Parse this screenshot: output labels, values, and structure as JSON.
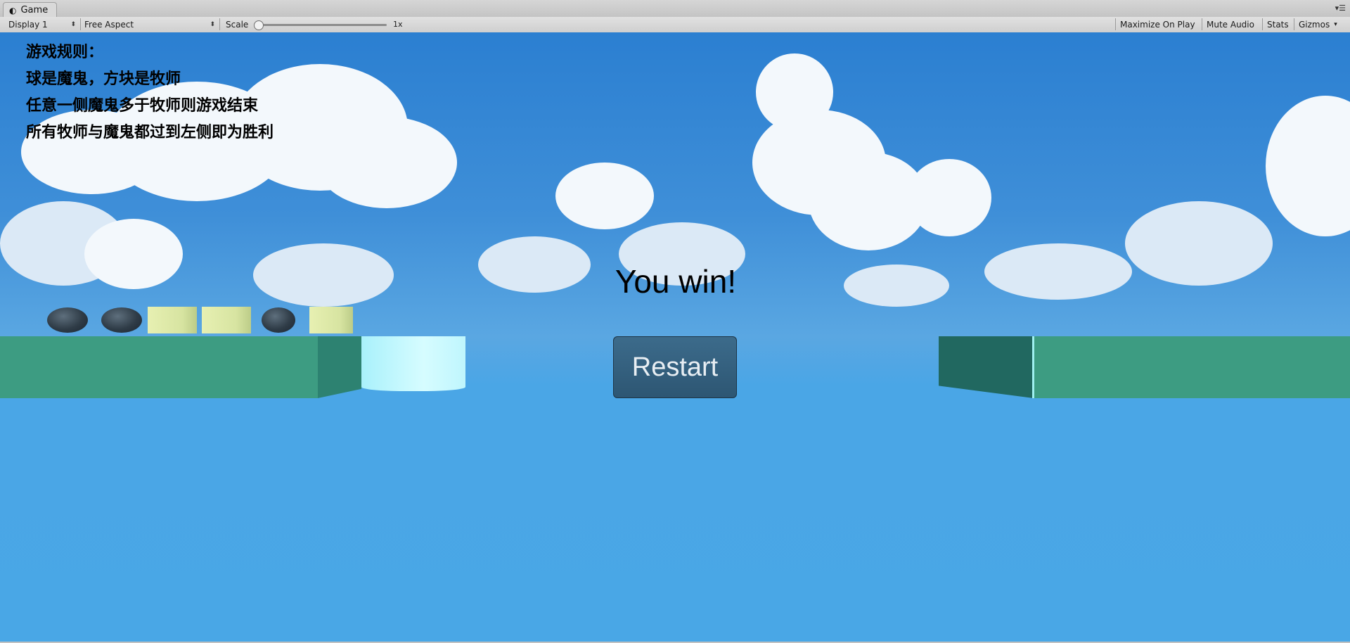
{
  "window": {
    "tab_title": "Game",
    "tab_icon": "unity-game-icon"
  },
  "toolbar": {
    "display": "Display 1",
    "aspect": "Free Aspect",
    "scale_label": "Scale",
    "scale_value": "1x",
    "maximize": "Maximize On Play",
    "mute": "Mute Audio",
    "stats": "Stats",
    "gizmos": "Gizmos"
  },
  "game": {
    "rules": [
      "游戏规则：",
      "球是魔鬼，方块是牧师",
      "任意一侧魔鬼多于牧师则游戏结束",
      "所有牧师与魔鬼都过到左侧即为胜利"
    ],
    "message": "You win!",
    "restart_label": "Restart",
    "left_bank_pieces": [
      "devil",
      "devil",
      "priest",
      "priest",
      "devil",
      "priest"
    ],
    "colors": {
      "sky": "#49a7e6",
      "bank": "#3d9c82",
      "button": "#2f5a78",
      "boat": "#c8f8ff"
    }
  }
}
